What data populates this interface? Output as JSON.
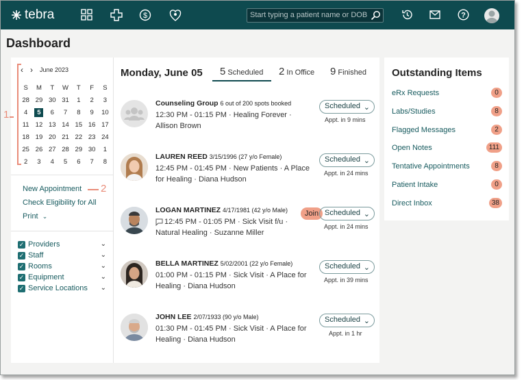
{
  "app": {
    "name": "tebra"
  },
  "search": {
    "placeholder": "Start typing a patient name or DOB"
  },
  "page": {
    "title": "Dashboard"
  },
  "calendar": {
    "month": "June 2023",
    "weekdays": [
      "S",
      "M",
      "T",
      "W",
      "T",
      "F",
      "S"
    ],
    "days": [
      "28",
      "29",
      "30",
      "31",
      "1",
      "2",
      "3",
      "4",
      "5",
      "6",
      "7",
      "8",
      "9",
      "10",
      "11",
      "12",
      "13",
      "14",
      "15",
      "16",
      "17",
      "18",
      "19",
      "20",
      "21",
      "22",
      "23",
      "24",
      "25",
      "26",
      "27",
      "28",
      "29",
      "30",
      "1",
      "2",
      "3",
      "4",
      "5",
      "6",
      "7",
      "8"
    ],
    "selected": "5"
  },
  "callouts": {
    "one": "1",
    "two": "2"
  },
  "links": {
    "new_appointment": "New Appointment",
    "check_eligibility": "Check Eligibility for All",
    "print": "Print"
  },
  "filters": [
    "Providers",
    "Staff",
    "Rooms",
    "Equipment",
    "Service Locations"
  ],
  "schedule": {
    "day": "Monday, June 05",
    "tabs": [
      {
        "count": "5",
        "label": "Scheduled"
      },
      {
        "count": "2",
        "label": "In Office"
      },
      {
        "count": "9",
        "label": "Finished"
      }
    ],
    "join_label": "Join",
    "appointments": [
      {
        "name": "Counseling Group",
        "meta": "6 out of 200 spots booked",
        "details": "12:30 PM - 01:15 PM · Healing Forever · Allison Brown",
        "status": "Scheduled",
        "when": "Appt. in 9 mins"
      },
      {
        "name": "LAUREN REED",
        "meta": "3/15/1996 (27 y/o Female)",
        "details": "12:45 PM - 01:45 PM · New Patients · A Place for Healing · Diana Hudson",
        "status": "Scheduled",
        "when": "Appt. in 24 mins"
      },
      {
        "name": "LOGAN MARTINEZ",
        "meta": "4/17/1981 (42 y/o Male)",
        "details": "12:45 PM - 01:05 PM · Sick Visit f/u · Natural Healing · Suzanne Miller",
        "status": "Scheduled",
        "when": "Appt. in 24 mins"
      },
      {
        "name": "BELLA MARTINEZ",
        "meta": "5/02/2001 (22 y/o Female)",
        "details": "01:00 PM - 01:15 PM · Sick Visit · A Place for Healing · Diana Hudson",
        "status": "Scheduled",
        "when": "Appt. in 39 mins"
      },
      {
        "name": "JOHN LEE",
        "meta": "2/07/1933 (90 y/o Male)",
        "details": "01:30 PM - 01:45 PM · Sick Visit · A Place for Healing · Diana Hudson",
        "status": "Scheduled",
        "when": "Appt. in 1 hr"
      }
    ]
  },
  "outstanding": {
    "title": "Outstanding Items",
    "items": [
      {
        "label": "eRx Requests",
        "count": "0"
      },
      {
        "label": "Labs/Studies",
        "count": "8"
      },
      {
        "label": "Flagged Messages",
        "count": "2"
      },
      {
        "label": "Open Notes",
        "count": "111"
      },
      {
        "label": "Tentative Appointments",
        "count": "8"
      },
      {
        "label": "Patient Intake",
        "count": "0"
      },
      {
        "label": "Direct Inbox",
        "count": "38"
      }
    ]
  }
}
